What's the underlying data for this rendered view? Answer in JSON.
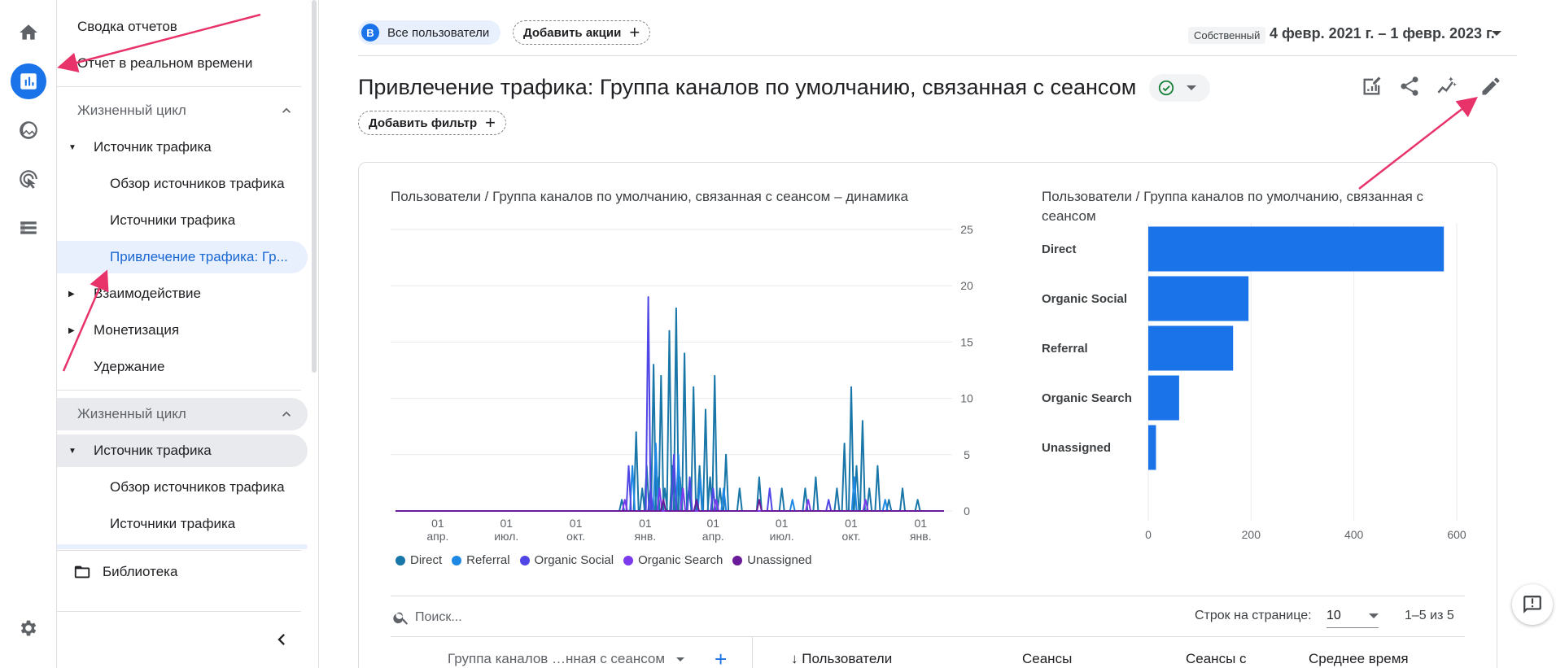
{
  "rail": {
    "items": [
      {
        "icon": "home-icon",
        "active": false
      },
      {
        "icon": "reports-icon",
        "active": true
      },
      {
        "icon": "explore-icon",
        "active": false
      },
      {
        "icon": "advertising-icon",
        "active": false
      },
      {
        "icon": "configure-icon",
        "active": false
      }
    ],
    "settings_icon": "settings-icon"
  },
  "sidebar": {
    "report_summary": "Сводка отчетов",
    "realtime": "Отчет в реальном времени",
    "group1": "Жизненный цикл",
    "acquisition": "Источник трафика",
    "acq_overview": "Обзор источников трафика",
    "acq_sources": "Источники трафика",
    "acq_traffic": "Привлечение трафика: Гр...",
    "engagement": "Взаимодействие",
    "monetization": "Монетизация",
    "retention": "Удержание",
    "group2": "Жизненный цикл",
    "acquisition2": "Источник трафика",
    "acq_overview2": "Обзор источников трафика",
    "acq_sources2": "Источники трафика",
    "library": "Библиотека"
  },
  "topbar": {
    "user_segment": "Все пользователи",
    "user_avatar": "В",
    "add_comparison": "Добавить акции",
    "date_badge": "Собственный",
    "date_range": "4 февр. 2021 г. – 1 февр. 2023 г."
  },
  "report": {
    "title": "Привлечение трафика: Группа каналов по умолчанию, связанная с сеансом",
    "add_filter": "Добавить фильтр"
  },
  "colors": {
    "accent": "#1a73e8",
    "direct": "#1976a8",
    "referral": "#1e88e5",
    "organic_social": "#4f46e5",
    "organic_search": "#7c3aed",
    "unassigned": "#6a1b9a",
    "bar": "#1a73e8",
    "annotation_arrow": "#e8336a",
    "check_green": "#188038"
  },
  "chart_data": [
    {
      "type": "line",
      "title": "Пользователи / Группа каналов по умолчанию, связанная с сеансом – динамика",
      "x_tick_labels": [
        {
          "day": "01",
          "month": "апр."
        },
        {
          "day": "01",
          "month": "июл."
        },
        {
          "day": "01",
          "month": "окт."
        },
        {
          "day": "01",
          "month": "янв."
        },
        {
          "day": "01",
          "month": "апр."
        },
        {
          "day": "01",
          "month": "июл."
        },
        {
          "day": "01",
          "month": "окт."
        },
        {
          "day": "01",
          "month": "янв."
        }
      ],
      "x_range": [
        "2021-02-04",
        "2023-02-01"
      ],
      "ylim": [
        0,
        25
      ],
      "y_ticks": [
        0,
        5,
        10,
        15,
        20,
        25
      ],
      "y_axis_side": "right",
      "grid": true,
      "legend_position": "bottom",
      "series": [
        {
          "name": "Direct",
          "values": [
            {
              "x": "2021-12-01",
              "y": 1
            },
            {
              "x": "2021-12-20",
              "y": 7
            },
            {
              "x": "2021-12-28",
              "y": 2
            },
            {
              "x": "2022-01-03",
              "y": 4
            },
            {
              "x": "2022-01-12",
              "y": 13
            },
            {
              "x": "2022-01-17",
              "y": 3
            },
            {
              "x": "2022-01-22",
              "y": 12
            },
            {
              "x": "2022-01-27",
              "y": 2
            },
            {
              "x": "2022-02-02",
              "y": 16
            },
            {
              "x": "2022-02-06",
              "y": 4
            },
            {
              "x": "2022-02-11",
              "y": 18
            },
            {
              "x": "2022-02-16",
              "y": 3
            },
            {
              "x": "2022-02-22",
              "y": 14
            },
            {
              "x": "2022-02-28",
              "y": 2
            },
            {
              "x": "2022-03-06",
              "y": 11
            },
            {
              "x": "2022-03-14",
              "y": 4
            },
            {
              "x": "2022-03-22",
              "y": 9
            },
            {
              "x": "2022-03-28",
              "y": 3
            },
            {
              "x": "2022-04-03",
              "y": 12
            },
            {
              "x": "2022-04-10",
              "y": 2
            },
            {
              "x": "2022-04-18",
              "y": 5
            },
            {
              "x": "2022-05-06",
              "y": 2
            },
            {
              "x": "2022-06-01",
              "y": 3
            },
            {
              "x": "2022-07-01",
              "y": 2
            },
            {
              "x": "2022-08-01",
              "y": 2
            },
            {
              "x": "2022-08-15",
              "y": 3
            },
            {
              "x": "2022-09-12",
              "y": 2
            },
            {
              "x": "2022-09-22",
              "y": 6
            },
            {
              "x": "2022-10-01",
              "y": 11
            },
            {
              "x": "2022-10-08",
              "y": 4
            },
            {
              "x": "2022-10-16",
              "y": 8
            },
            {
              "x": "2022-10-25",
              "y": 2
            },
            {
              "x": "2022-11-05",
              "y": 4
            },
            {
              "x": "2022-11-20",
              "y": 1
            },
            {
              "x": "2022-12-08",
              "y": 2
            },
            {
              "x": "2022-12-28",
              "y": 1
            }
          ]
        },
        {
          "name": "Referral",
          "values": [
            {
              "x": "2021-12-15",
              "y": 4
            },
            {
              "x": "2022-01-15",
              "y": 6
            },
            {
              "x": "2022-02-14",
              "y": 5
            },
            {
              "x": "2022-03-15",
              "y": 3
            },
            {
              "x": "2022-04-15",
              "y": 2
            },
            {
              "x": "2022-07-15",
              "y": 1
            },
            {
              "x": "2022-10-05",
              "y": 3
            },
            {
              "x": "2022-11-15",
              "y": 1
            }
          ]
        },
        {
          "name": "Organic Social",
          "values": [
            {
              "x": "2021-12-10",
              "y": 4
            },
            {
              "x": "2022-01-05",
              "y": 19
            },
            {
              "x": "2022-01-08",
              "y": 2
            },
            {
              "x": "2022-02-08",
              "y": 5
            },
            {
              "x": "2022-03-01",
              "y": 3
            },
            {
              "x": "2022-04-01",
              "y": 2
            },
            {
              "x": "2022-06-15",
              "y": 2
            },
            {
              "x": "2022-09-01",
              "y": 1
            }
          ]
        },
        {
          "name": "Organic Search",
          "values": [
            {
              "x": "2021-12-05",
              "y": 1
            },
            {
              "x": "2022-01-20",
              "y": 2
            },
            {
              "x": "2022-02-20",
              "y": 2
            },
            {
              "x": "2022-04-05",
              "y": 1
            },
            {
              "x": "2022-08-05",
              "y": 1
            },
            {
              "x": "2022-10-20",
              "y": 1
            }
          ]
        },
        {
          "name": "Unassigned",
          "values": [
            {
              "x": "2022-01-25",
              "y": 1
            },
            {
              "x": "2022-03-10",
              "y": 1
            },
            {
              "x": "2022-06-01",
              "y": 1
            }
          ]
        }
      ]
    },
    {
      "type": "bar",
      "orientation": "horizontal",
      "title": "Пользователи / Группа каналов по умолчанию, связанная с сеансом",
      "categories": [
        "Direct",
        "Organic Social",
        "Referral",
        "Organic Search",
        "Unassigned"
      ],
      "values": [
        575,
        195,
        165,
        60,
        15
      ],
      "xlim": [
        0,
        600
      ],
      "x_ticks": [
        0,
        200,
        400,
        600
      ],
      "grid": true
    }
  ],
  "table": {
    "search_placeholder": "Поиск...",
    "rows_label": "Строк на странице:",
    "rows_value": "10",
    "pager": "1–5 из 5",
    "dimension_header": "Группа каналов …нная с сеансом",
    "columns": [
      "Пользователи",
      "Сеансы",
      "Сеансы с",
      "Среднее время"
    ],
    "sort_arrow": "↓"
  }
}
